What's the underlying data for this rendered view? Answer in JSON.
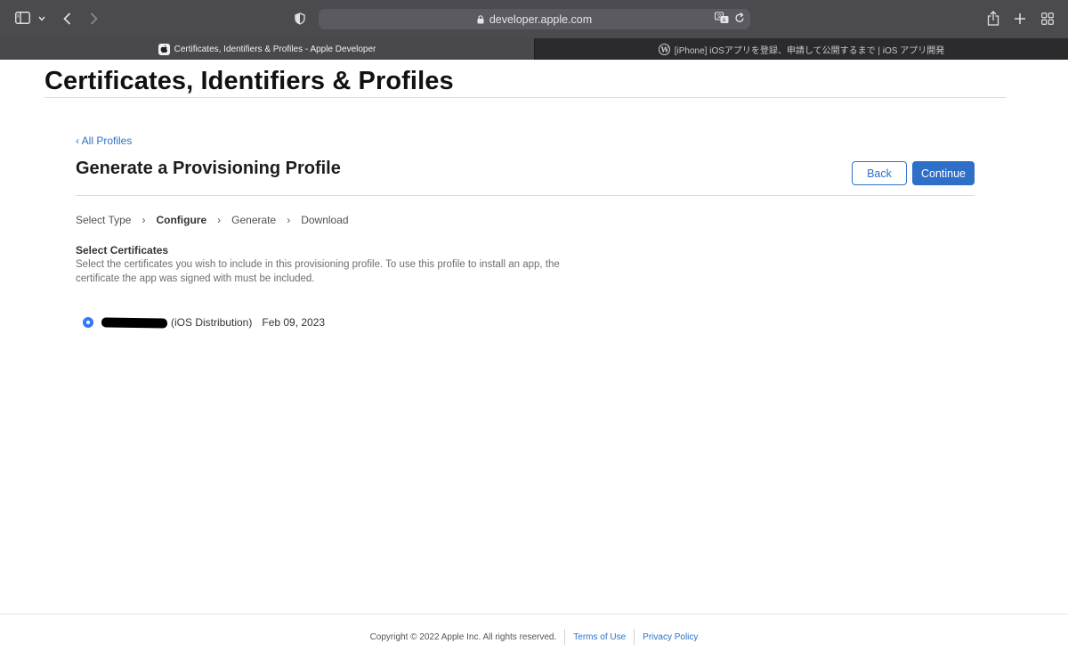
{
  "browser": {
    "url": "developer.apple.com",
    "tabs": [
      {
        "title": "Certificates, Identifiers & Profiles - Apple Developer",
        "active": true,
        "favicon": "apple-icon"
      },
      {
        "title": "[iPhone] iOSアプリを登録、申請して公開するまで | iOS アプリ開発",
        "active": false,
        "favicon": "wordpress-icon"
      }
    ]
  },
  "page": {
    "title": "Certificates, Identifiers & Profiles",
    "back_link": "‹ All Profiles",
    "section_title": "Generate a Provisioning Profile",
    "buttons": {
      "back": "Back",
      "continue": "Continue"
    },
    "steps": [
      {
        "label": "Select Type",
        "current": false
      },
      {
        "label": "Configure",
        "current": true
      },
      {
        "label": "Generate",
        "current": false
      },
      {
        "label": "Download",
        "current": false
      }
    ],
    "step_separator": "›",
    "certificates": {
      "heading": "Select Certificates",
      "description": "Select the certificates you wish to include in this provisioning profile. To use this profile to install an app, the certificate the app was signed with must be included.",
      "items": [
        {
          "type": "(iOS Distribution)",
          "date": "Feb 09, 2023",
          "selected": true
        }
      ]
    }
  },
  "footer": {
    "copyright": "Copyright © 2022 Apple Inc. All rights reserved.",
    "terms": "Terms of Use",
    "privacy": "Privacy Policy"
  },
  "colors": {
    "accent": "#2e6fc7",
    "link": "#2b72c9",
    "radio": "#3478f6",
    "toolbar": "#4a4a4f"
  }
}
